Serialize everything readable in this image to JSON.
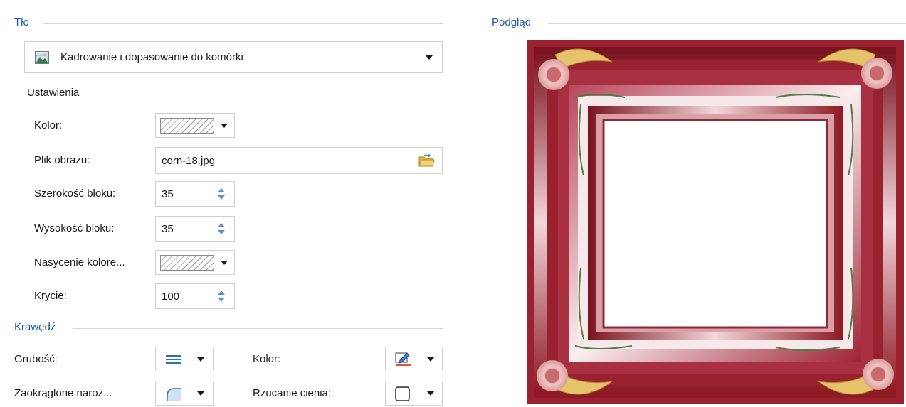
{
  "background": {
    "title": "Tło",
    "fill_type": "Kadrowanie i dopasowanie do komórki",
    "settings_title": "Ustawienia",
    "color_label": "Kolor:",
    "image_file_label": "Plik obrazu:",
    "image_file_value": "corn-18.jpg",
    "block_width_label": "Szerokość bloku:",
    "block_width_value": "35",
    "block_height_label": "Wysokość bloku:",
    "block_height_value": "35",
    "saturation_label": "Nasycenie kolore...",
    "opacity_label": "Krycie:",
    "opacity_value": "100"
  },
  "border": {
    "title": "Krawędź",
    "thickness_label": "Grubość:",
    "color_label": "Kolor:",
    "rounded_corners_label": "Zaokrąglone naroż...",
    "shadow_label": "Rzucanie cienia:"
  },
  "preview": {
    "title": "Podgląd"
  },
  "colors": {
    "accent": "#1e5aa8",
    "frame_red": "#8e1a24",
    "spinner_blue": "#5a8fcf"
  }
}
